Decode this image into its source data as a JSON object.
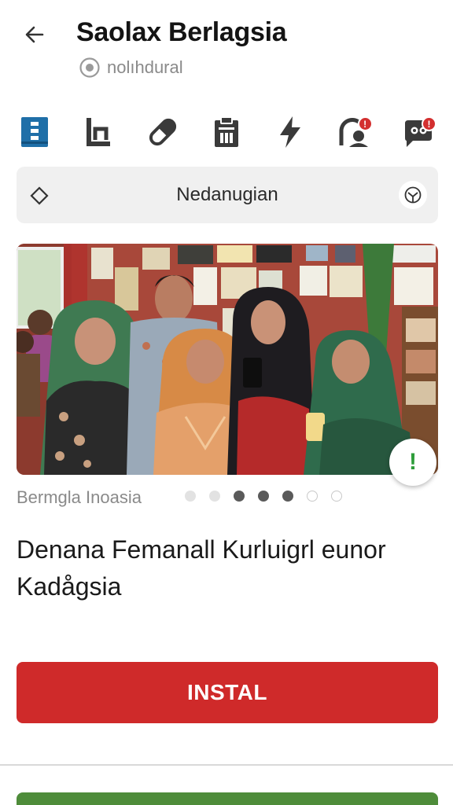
{
  "header": {
    "title": "Saolax Berlagsia",
    "subtitle": "nolıhdural"
  },
  "toolbar": {
    "icons": [
      "calendar-grid-icon",
      "chart-icon",
      "pill-icon",
      "clipboard-icon",
      "lightning-icon",
      "alert-person-icon",
      "chat-bot-icon"
    ],
    "badges": {
      "alert": "!",
      "chat": "!"
    }
  },
  "search": {
    "label": "Nedanugian"
  },
  "gallery": {
    "caption": "Bermgla Inoasia",
    "active_indices": [
      2,
      3,
      4
    ],
    "dot_count": 7
  },
  "article": {
    "headline": "Denana Femanall Kurluigrl eunor Kadågsia"
  },
  "actions": {
    "install_label": "INSTAL"
  },
  "colors": {
    "accent": "#cf2a2a",
    "blue_icon": "#1f6fa8",
    "fab_green": "#2e9d3a",
    "bottom_green": "#4e8c3a"
  }
}
